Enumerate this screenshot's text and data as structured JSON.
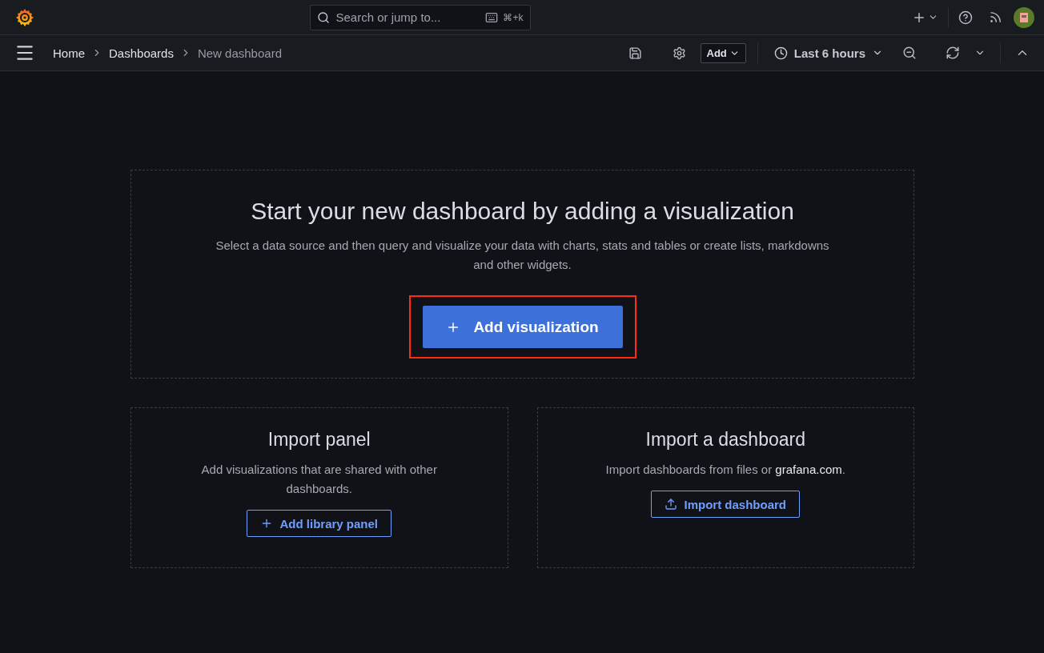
{
  "top_bar": {
    "search": {
      "placeholder": "Search or jump to...",
      "shortcut": "⌘+k"
    }
  },
  "breadcrumbs": [
    {
      "label": "Home",
      "current": false
    },
    {
      "label": "Dashboards",
      "current": false
    },
    {
      "label": "New dashboard",
      "current": true
    }
  ],
  "toolbar": {
    "add_button": "Add",
    "time_range": "Last 6 hours"
  },
  "hero": {
    "title": "Start your new dashboard by adding a visualization",
    "description": "Select a data source and then query and visualize your data with charts, stats and tables or create lists, markdowns and other widgets.",
    "button": {
      "label": "Add visualization",
      "highlighted": true
    }
  },
  "cards": [
    {
      "kind": "library",
      "title": "Import panel",
      "description": "Add visualizations that are shared with other dashboards.",
      "button": "Add library panel"
    },
    {
      "kind": "import",
      "title": "Import a dashboard",
      "description": "Import dashboards from files or ",
      "link": "grafana.com",
      "description_end": ".",
      "button": "Import dashboard"
    }
  ]
}
